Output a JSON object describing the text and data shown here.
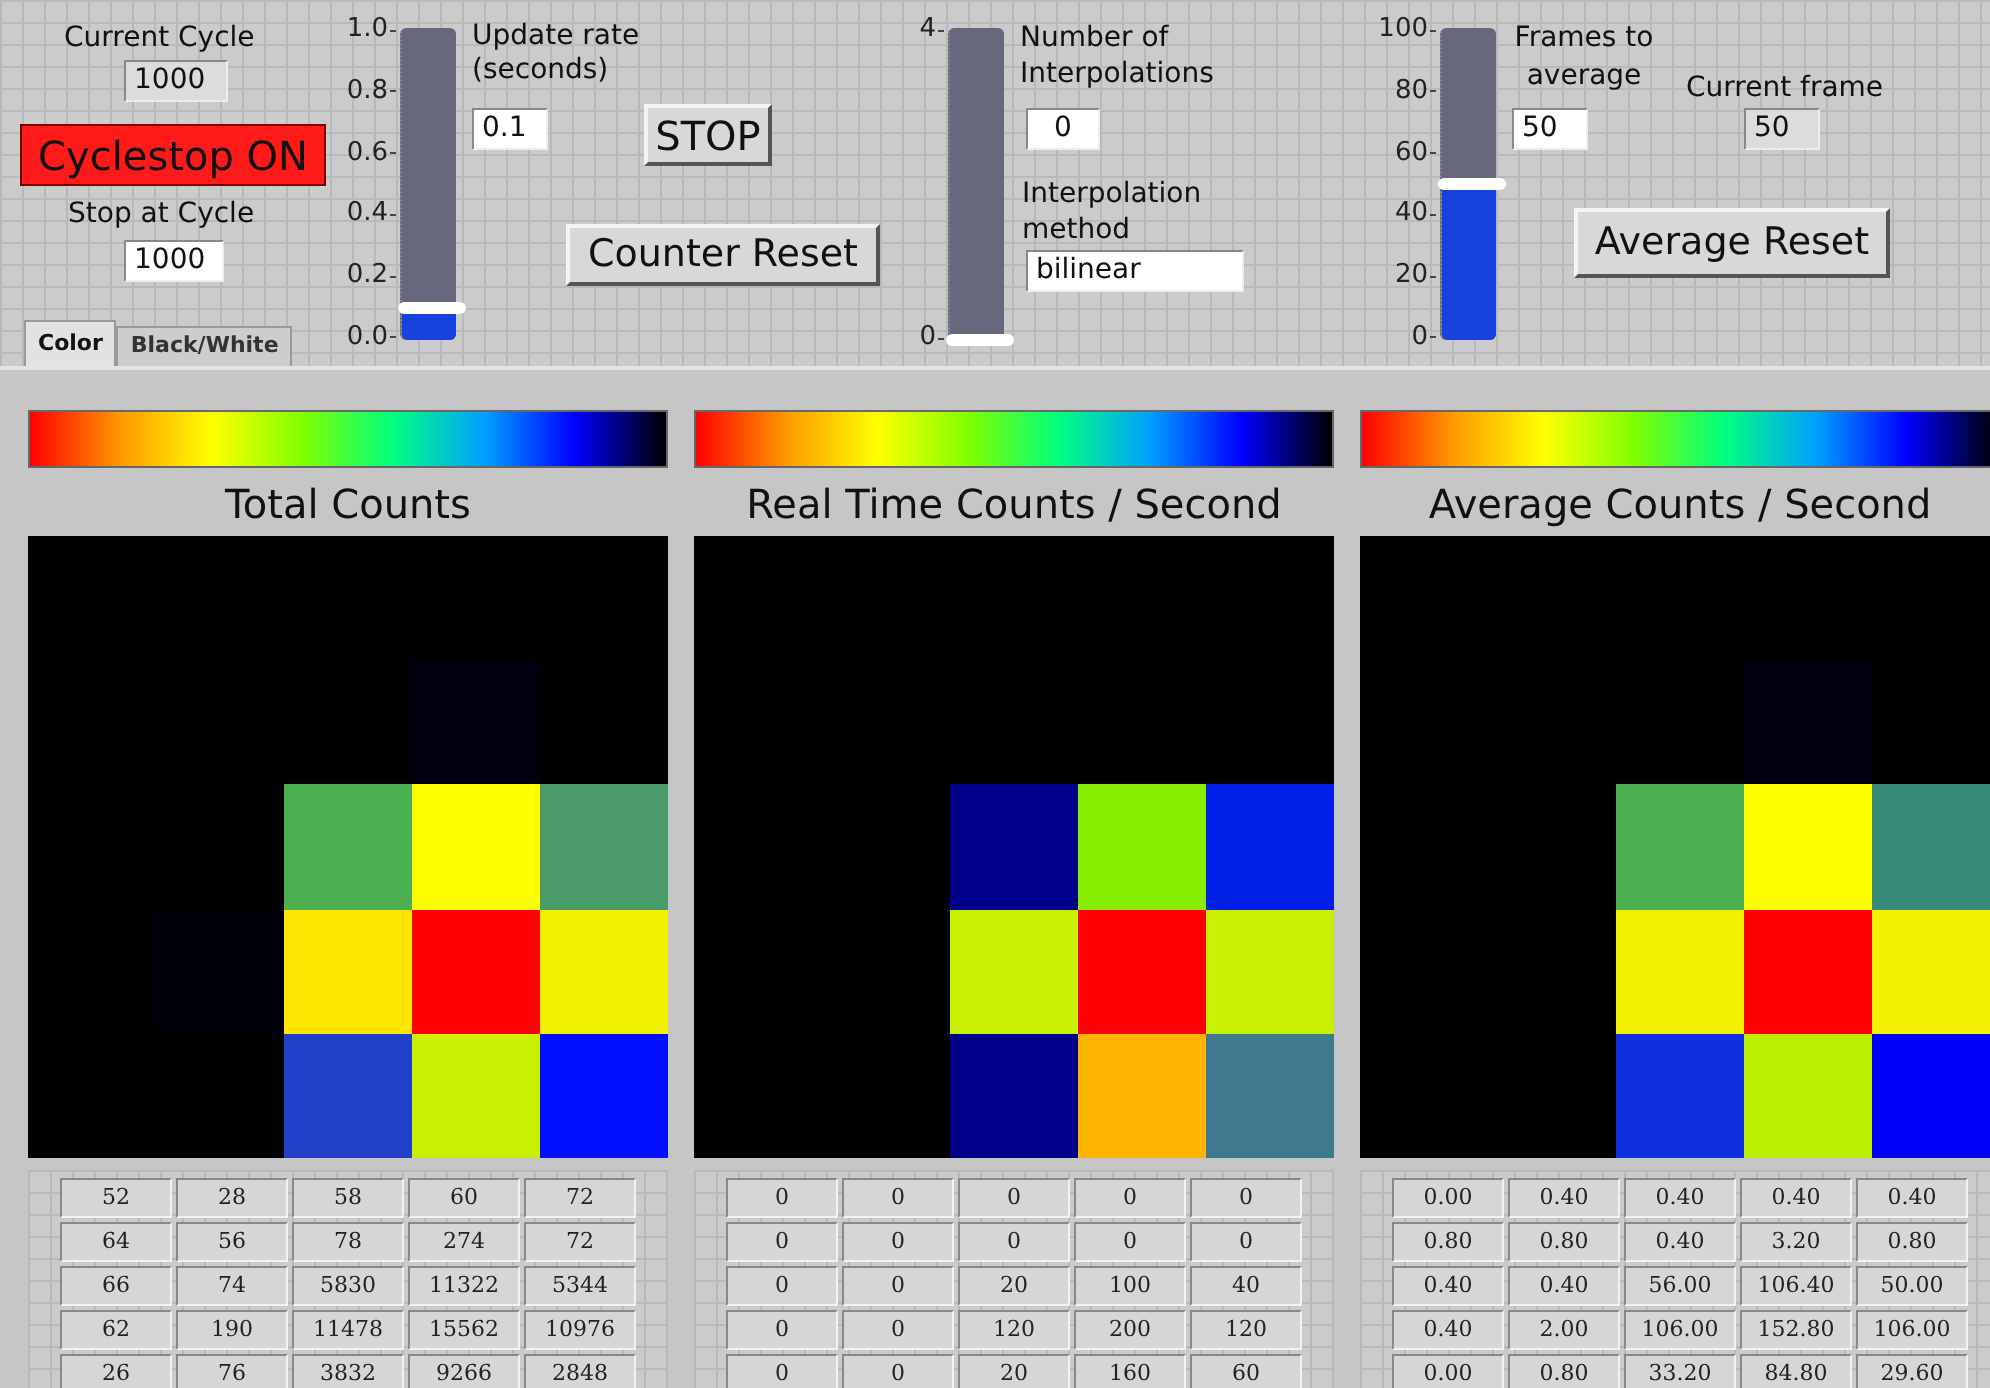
{
  "controls": {
    "current_cycle": {
      "label": "Current Cycle",
      "value": "1000"
    },
    "cyclestop": {
      "label": "Cyclestop ON",
      "on": true
    },
    "stop_at_cycle": {
      "label": "Stop at Cycle",
      "value": "1000"
    },
    "update_slider": {
      "ticks": [
        "1.0",
        "0.8",
        "0.6",
        "0.4",
        "0.2",
        "0.0"
      ],
      "level": 0.1
    },
    "update_rate": {
      "label": "Update rate (seconds)",
      "value": "0.1"
    },
    "stop_button": "STOP",
    "counter_reset": "Counter Reset",
    "interpolation_slider": {
      "ticks": [
        "4",
        "0"
      ],
      "level": 0
    },
    "interpolations": {
      "label": "Number of Interpolations",
      "value": "0"
    },
    "interpolation_method": {
      "label": "Interpolation method",
      "value": "bilinear"
    },
    "frames_slider": {
      "ticks": [
        "100",
        "80",
        "60",
        "40",
        "20",
        "0"
      ],
      "level": 0.5
    },
    "frames_to_average": {
      "label": "Frames to average",
      "value": "50"
    },
    "current_frame": {
      "label": "Current frame",
      "value": "50"
    },
    "average_reset": "Average Reset"
  },
  "tabs": [
    {
      "label": "Color",
      "selected": true
    },
    {
      "label": "Black/White",
      "selected": false
    }
  ],
  "panels": [
    {
      "title": "Total Counts",
      "cells": [
        [
          {
            "color": "#000000"
          },
          {
            "color": "#000000"
          },
          {
            "color": "#000000"
          },
          {
            "color": "#000000"
          },
          {
            "color": "#000000"
          }
        ],
        [
          {
            "color": "#000000"
          },
          {
            "color": "#000000"
          },
          {
            "color": "#000000"
          },
          {
            "color": "#00000f"
          },
          {
            "color": "#000000"
          }
        ],
        [
          {
            "color": "#000000"
          },
          {
            "color": "#000000"
          },
          {
            "color": "#4caf50"
          },
          {
            "color": "#ffff00"
          },
          {
            "color": "#4a9a6a"
          }
        ],
        [
          {
            "color": "#000000"
          },
          {
            "color": "#00000a"
          },
          {
            "color": "#ffe600"
          },
          {
            "color": "#ff0000"
          },
          {
            "color": "#f0f000"
          }
        ],
        [
          {
            "color": "#000000"
          },
          {
            "color": "#000000"
          },
          {
            "color": "#2040c8"
          },
          {
            "color": "#c8f000"
          },
          {
            "color": "#0010ff"
          }
        ]
      ],
      "table": [
        [
          "52",
          "28",
          "58",
          "60",
          "72"
        ],
        [
          "64",
          "56",
          "78",
          "274",
          "72"
        ],
        [
          "66",
          "74",
          "5830",
          "11322",
          "5344"
        ],
        [
          "62",
          "190",
          "11478",
          "15562",
          "10976"
        ],
        [
          "26",
          "76",
          "3832",
          "9266",
          "2848"
        ]
      ]
    },
    {
      "title": "Real Time Counts / Second",
      "cells": [
        [
          {
            "color": "#000000"
          },
          {
            "color": "#000000"
          },
          {
            "color": "#000000"
          },
          {
            "color": "#000000"
          },
          {
            "color": "#000000"
          }
        ],
        [
          {
            "color": "#000000"
          },
          {
            "color": "#000000"
          },
          {
            "color": "#000000"
          },
          {
            "color": "#000000"
          },
          {
            "color": "#000000"
          }
        ],
        [
          {
            "color": "#000000"
          },
          {
            "color": "#000000"
          },
          {
            "color": "#00008b"
          },
          {
            "color": "#88ee00"
          },
          {
            "color": "#0020e8"
          }
        ],
        [
          {
            "color": "#000000"
          },
          {
            "color": "#000000"
          },
          {
            "color": "#c8f000"
          },
          {
            "color": "#ff0000"
          },
          {
            "color": "#c8f000"
          }
        ],
        [
          {
            "color": "#000000"
          },
          {
            "color": "#000000"
          },
          {
            "color": "#00008b"
          },
          {
            "color": "#ffb400"
          },
          {
            "color": "#407890"
          }
        ]
      ],
      "table": [
        [
          "0",
          "0",
          "0",
          "0",
          "0"
        ],
        [
          "0",
          "0",
          "0",
          "0",
          "0"
        ],
        [
          "0",
          "0",
          "20",
          "100",
          "40"
        ],
        [
          "0",
          "0",
          "120",
          "200",
          "120"
        ],
        [
          "0",
          "0",
          "20",
          "160",
          "60"
        ]
      ]
    },
    {
      "title": "Average Counts / Second",
      "cells": [
        [
          {
            "color": "#000000"
          },
          {
            "color": "#000000"
          },
          {
            "color": "#000000"
          },
          {
            "color": "#000000"
          },
          {
            "color": "#000000"
          }
        ],
        [
          {
            "color": "#000000"
          },
          {
            "color": "#000000"
          },
          {
            "color": "#000000"
          },
          {
            "color": "#00000f"
          },
          {
            "color": "#000000"
          }
        ],
        [
          {
            "color": "#000000"
          },
          {
            "color": "#000000"
          },
          {
            "color": "#4caf50"
          },
          {
            "color": "#ffff00"
          },
          {
            "color": "#3a8a7a"
          }
        ],
        [
          {
            "color": "#000000"
          },
          {
            "color": "#000000"
          },
          {
            "color": "#f0f000"
          },
          {
            "color": "#ff0000"
          },
          {
            "color": "#f0f000"
          }
        ],
        [
          {
            "color": "#000000"
          },
          {
            "color": "#000000"
          },
          {
            "color": "#1030e0"
          },
          {
            "color": "#b8f000"
          },
          {
            "color": "#0000ff"
          }
        ]
      ],
      "table": [
        [
          "0.00",
          "0.40",
          "0.40",
          "0.40",
          "0.40"
        ],
        [
          "0.80",
          "0.80",
          "0.40",
          "3.20",
          "0.80"
        ],
        [
          "0.40",
          "0.40",
          "56.00",
          "106.40",
          "50.00"
        ],
        [
          "0.40",
          "2.00",
          "106.00",
          "152.80",
          "106.00"
        ],
        [
          "0.00",
          "0.80",
          "33.20",
          "84.80",
          "29.60"
        ]
      ]
    }
  ]
}
